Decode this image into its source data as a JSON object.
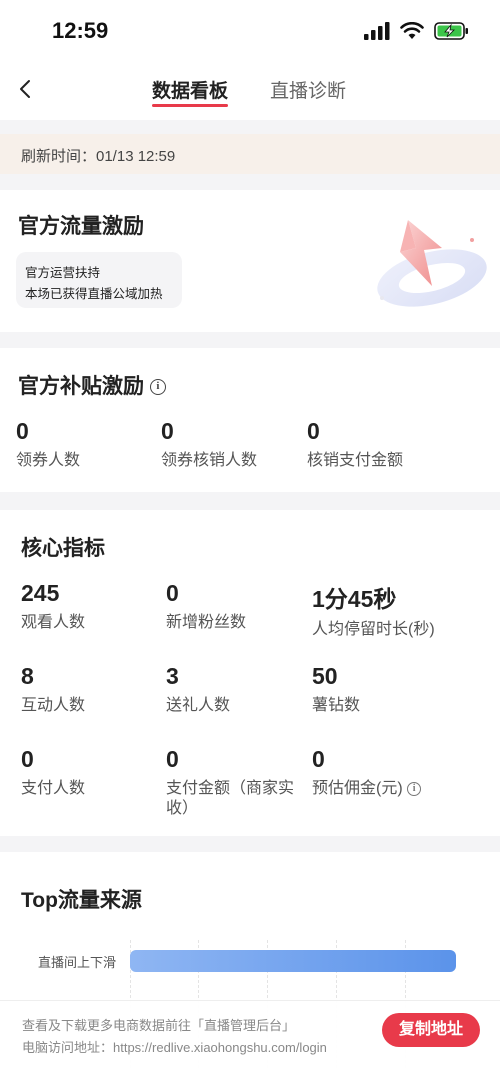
{
  "status_bar": {
    "time": "12:59"
  },
  "nav": {
    "tabs": [
      {
        "label": "数据看板",
        "active": true
      },
      {
        "label": "直播诊断",
        "active": false
      }
    ]
  },
  "refresh": {
    "text": "刷新时间：01/13 12:59"
  },
  "official_traffic": {
    "title": "官方流量激励",
    "badge_line1": "官方运营扶持",
    "badge_line2": "本场已获得直播公域加热"
  },
  "official_subsidy": {
    "title": "官方补贴激励",
    "metrics": [
      {
        "value": "0",
        "label": "领券人数"
      },
      {
        "value": "0",
        "label": "领券核销人数"
      },
      {
        "value": "0",
        "label": "核销支付金额"
      }
    ]
  },
  "core_metrics": {
    "title": "核心指标",
    "metrics": [
      {
        "value": "245",
        "label": "观看人数"
      },
      {
        "value": "0",
        "label": "新增粉丝数"
      },
      {
        "value": "1分45秒",
        "label": "人均停留时长(秒)"
      },
      {
        "value": "8",
        "label": "互动人数"
      },
      {
        "value": "3",
        "label": "送礼人数"
      },
      {
        "value": "50",
        "label": "薯钻数"
      },
      {
        "value": "0",
        "label": "支付人数"
      },
      {
        "value": "0",
        "label": "支付金额（商家实收）"
      },
      {
        "value": "0",
        "label": "预估佣金(元)"
      }
    ]
  },
  "traffic_source": {
    "title": "Top流量来源",
    "bar_label": "直播间上下滑",
    "bar_fraction": 1.0,
    "bar_color": "#6aa0ee"
  },
  "footer": {
    "line1": "查看及下载更多电商数据前往「直播管理后台」",
    "line2": "电脑访问地址：https://redlive.xiaohongshu.com/login",
    "copy_label": "复制地址"
  },
  "colors": {
    "accent": "#e83a4a",
    "refresh_bg": "#f7f0ea"
  }
}
